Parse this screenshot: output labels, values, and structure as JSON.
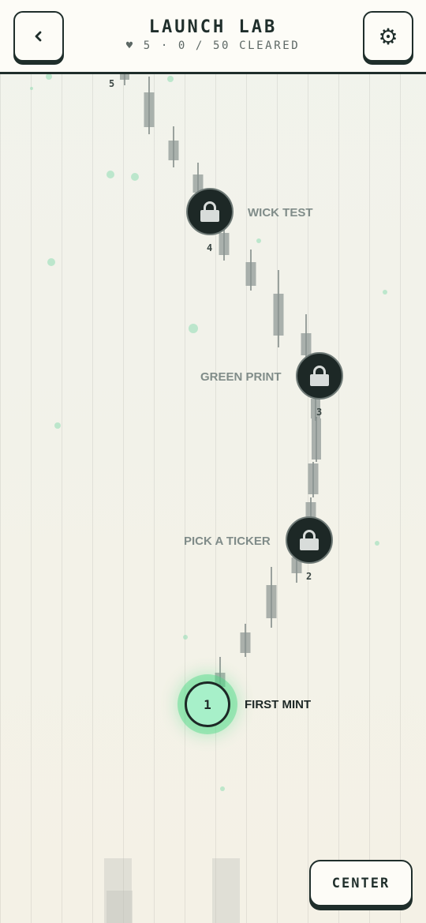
{
  "header": {
    "title": "LAUNCH LAB",
    "subtitle": "♥ 5 · 0 / 50 CLEARED",
    "back_icon": "chevron-left-icon",
    "settings_icon": "gear-icon",
    "settings_glyph": "⚙"
  },
  "levels": [
    {
      "number": "1",
      "label": "FIRST MINT",
      "state": "current"
    },
    {
      "number": "2",
      "label": "PICK A TICKER",
      "state": "locked"
    },
    {
      "number": "3",
      "label": "GREEN PRINT",
      "state": "locked"
    },
    {
      "number": "4",
      "label": "WICK TEST",
      "state": "locked"
    },
    {
      "number": "5",
      "label": "",
      "state": "locked"
    }
  ],
  "center_button": {
    "label": "CENTER"
  },
  "colors": {
    "ink": "#1f2e2b",
    "accent_green": "#4edb88",
    "locked_node": "#1d2826",
    "background": "#f3f1e8"
  }
}
